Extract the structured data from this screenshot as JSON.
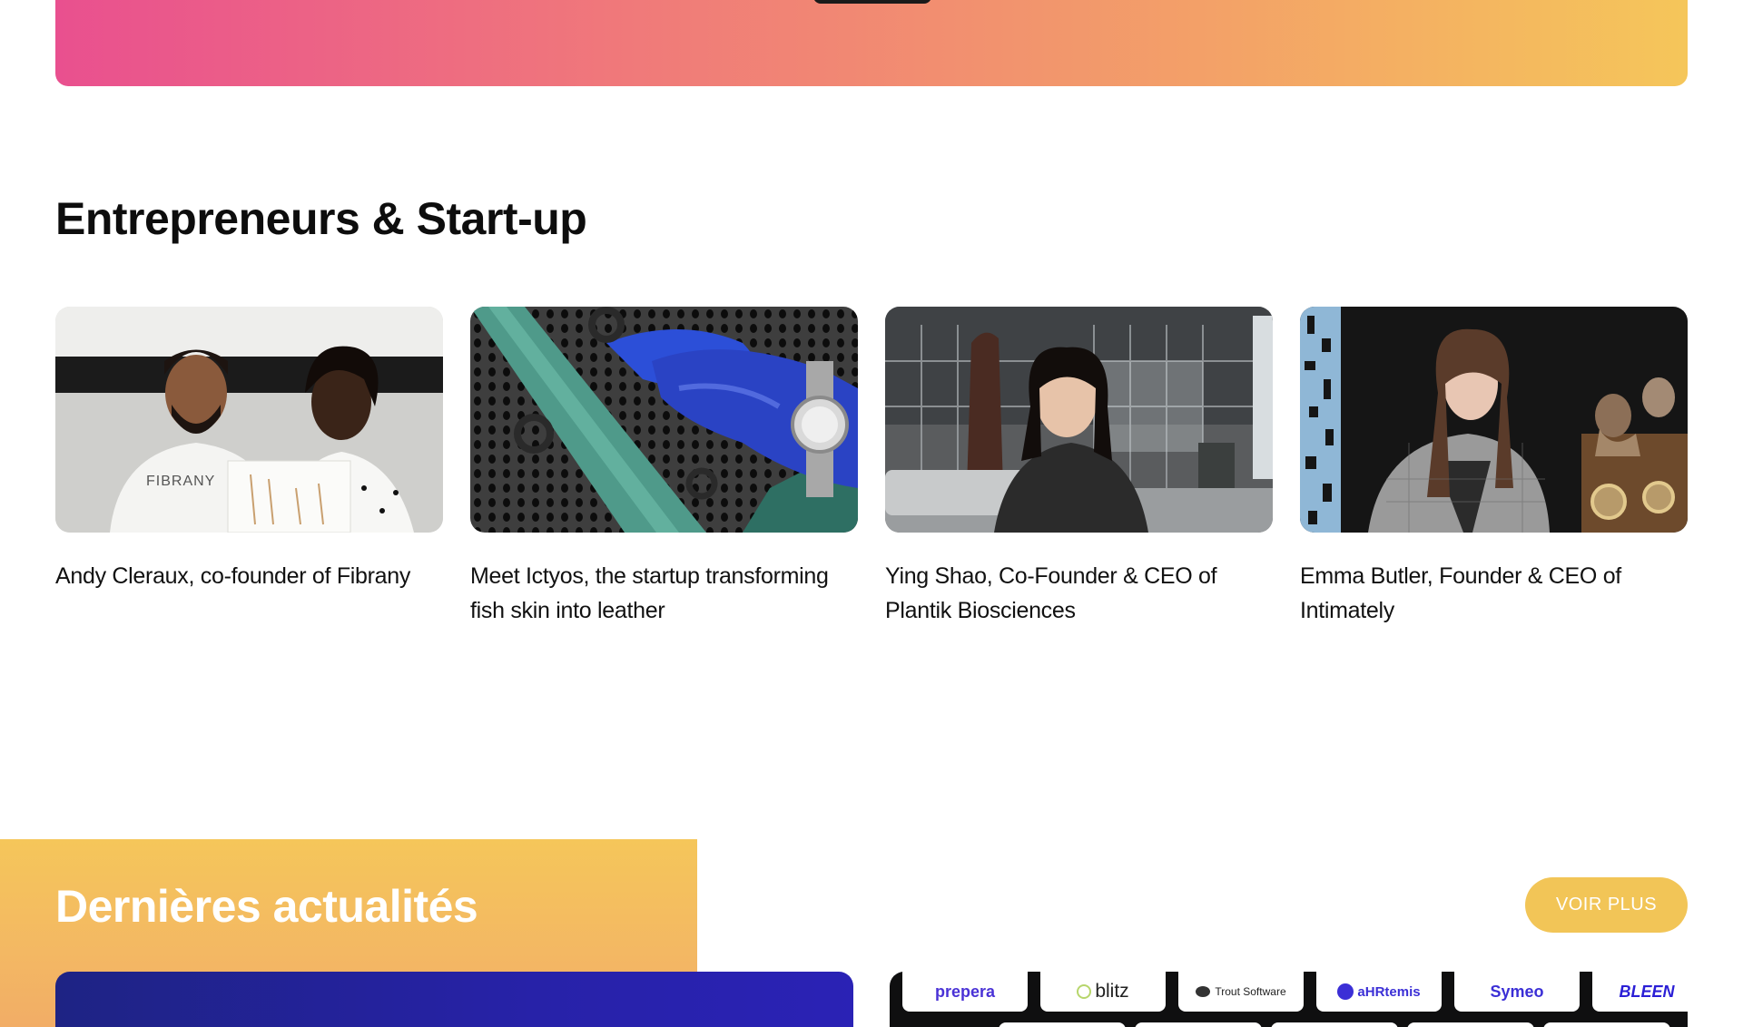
{
  "section": {
    "title": "Entrepreneurs & Start-up"
  },
  "cards": [
    {
      "caption": "Andy Cleraux, co-founder of Fibrany",
      "image_text": "FIBRANY"
    },
    {
      "caption": "Meet Ictyos, the startup transforming fish skin into leather"
    },
    {
      "caption": "Ying Shao, Co-Founder & CEO of Plantik Biosciences"
    },
    {
      "caption": "Emma Butler, Founder & CEO of Intimately"
    }
  ],
  "news": {
    "title": "Dernières actualités",
    "more_label": "VOIR PLUS"
  },
  "logos": [
    "prepera",
    "blitz",
    "Trout Software",
    "aHRtemis",
    "Symeo",
    "BLEEN"
  ],
  "colors": {
    "banner_gradient": [
      "#e9508f",
      "#f0797a",
      "#f3a068",
      "#f5c65a"
    ],
    "news_band": "#f5c65a",
    "button": "#f2c557",
    "logo_blue": "#3b2fd6",
    "left_card": "#2722a8"
  }
}
